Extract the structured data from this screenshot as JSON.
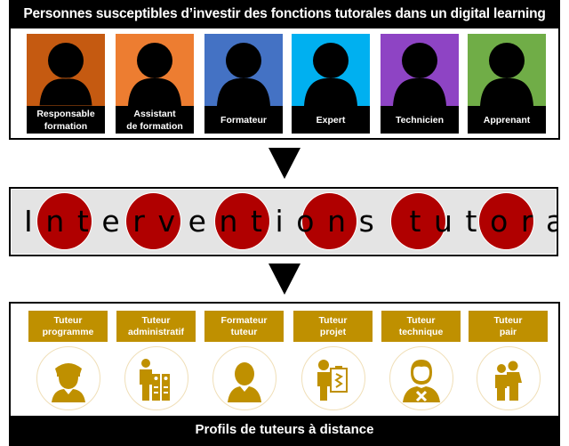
{
  "top_section": {
    "title": "Personnes susceptibles d’investir des fonctions tutorales dans un digital learning",
    "persons": [
      {
        "label": "Responsable\nformation",
        "color": "#c55a11",
        "icon": "person-silhouette-icon"
      },
      {
        "label": "Assistant\nde formation",
        "color": "#ed7d31",
        "icon": "person-silhouette-icon"
      },
      {
        "label": "Formateur",
        "color": "#4472c4",
        "icon": "person-silhouette-icon"
      },
      {
        "label": "Expert",
        "color": "#00b0f0",
        "icon": "person-silhouette-icon"
      },
      {
        "label": "Technicien",
        "color": "#8e44c4",
        "icon": "person-silhouette-icon"
      },
      {
        "label": "Apprenant",
        "color": "#70ad47",
        "icon": "person-silhouette-icon"
      }
    ]
  },
  "arrows": [
    "down-arrow-icon",
    "down-arrow-icon"
  ],
  "middle_section": {
    "text": "Interventions tutorales",
    "background": "#e4e4e4",
    "dot_color": "#b00000",
    "dot_count": 6
  },
  "bottom_section": {
    "accent": "#bf9000",
    "profiles": [
      {
        "label": "Tuteur\nprogramme",
        "icon": "officer-icon"
      },
      {
        "label": "Tuteur\nadministratif",
        "icon": "filing-cabinet-person-icon"
      },
      {
        "label": "Formateur\ntuteur",
        "icon": "person-bust-icon"
      },
      {
        "label": "Tuteur\nprojet",
        "icon": "clipboard-person-icon"
      },
      {
        "label": "Tuteur\ntechnique",
        "icon": "technician-tools-icon"
      },
      {
        "label": "Tuteur\npair",
        "icon": "two-people-icon"
      }
    ],
    "footer": "Profils de tuteurs à distance"
  }
}
